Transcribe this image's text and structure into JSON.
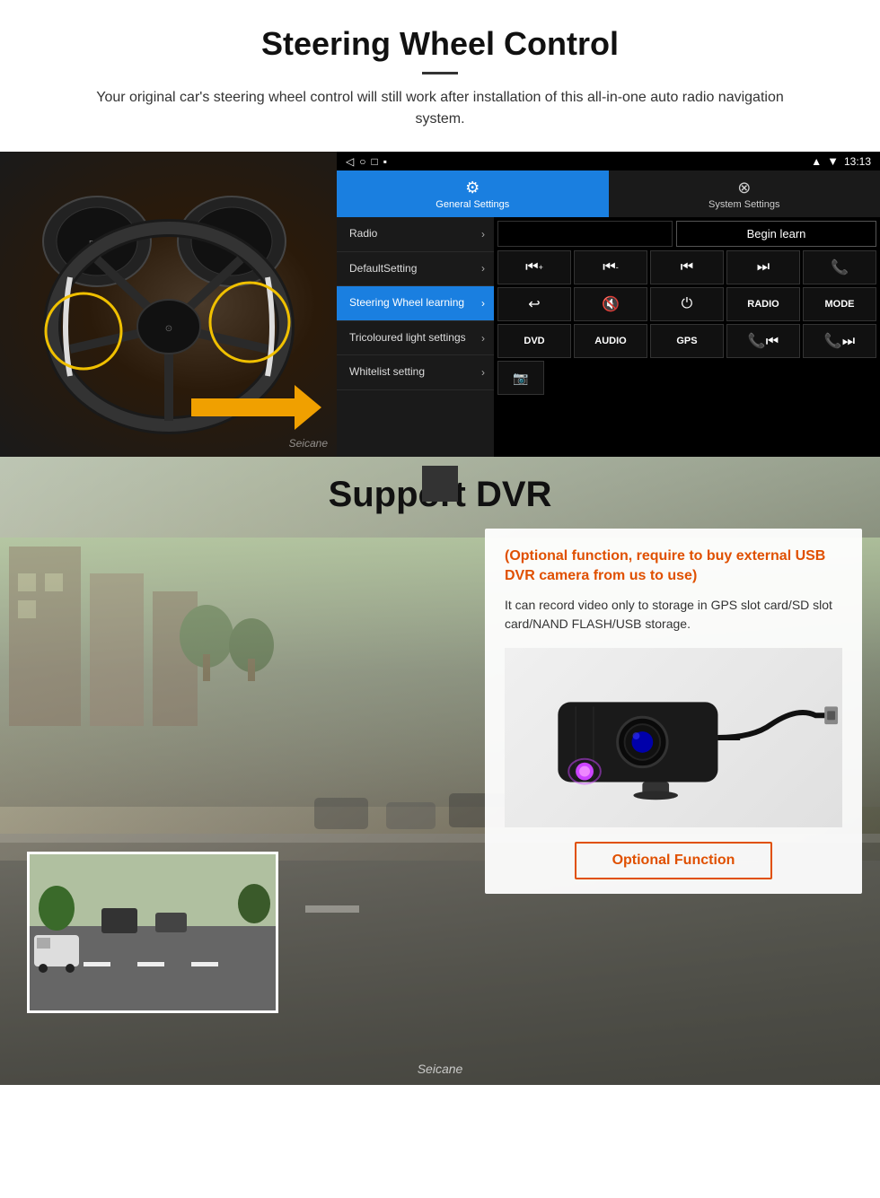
{
  "page": {
    "section1": {
      "title": "Steering Wheel Control",
      "description": "Your original car's steering wheel control will still work after installation of this all-in-one auto radio navigation system.",
      "android_ui": {
        "statusbar": {
          "signal": "▾",
          "wifi": "▾",
          "time": "13:13"
        },
        "tabs": [
          {
            "label": "General Settings",
            "active": true
          },
          {
            "label": "System Settings",
            "active": false
          }
        ],
        "menu_items": [
          {
            "label": "Radio",
            "active": false
          },
          {
            "label": "DefaultSetting",
            "active": false
          },
          {
            "label": "Steering Wheel learning",
            "active": true
          },
          {
            "label": "Tricoloured light settings",
            "active": false
          },
          {
            "label": "Whitelist setting",
            "active": false
          }
        ],
        "begin_learn_btn": "Begin learn",
        "control_buttons_row1": [
          "⏮+",
          "⏮-",
          "⏮",
          "⏭",
          "📞"
        ],
        "control_buttons_row2": [
          "↩",
          "🔇",
          "⏻",
          "RADIO",
          "MODE"
        ],
        "control_buttons_row3": [
          "DVD",
          "AUDIO",
          "GPS",
          "📞⏮",
          "📞⏭"
        ]
      }
    },
    "section2": {
      "title": "Support DVR",
      "card": {
        "title": "(Optional function, require to buy external USB DVR camera from us to use)",
        "text": "It can record video only to storage in GPS slot card/SD slot card/NAND FLASH/USB storage.",
        "optional_function_btn": "Optional Function"
      },
      "watermark": "Seicane"
    }
  }
}
